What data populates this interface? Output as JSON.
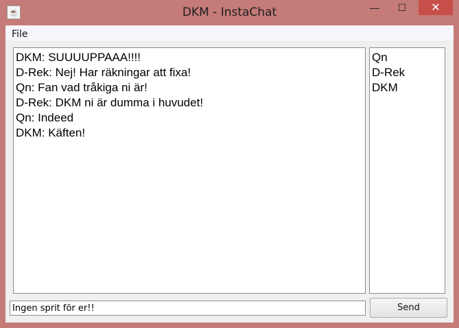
{
  "window": {
    "title": "DKM - InstaChat",
    "app_icon": "java-icon",
    "minimize_glyph": "—",
    "maximize_glyph": "☐",
    "close_glyph": "✕"
  },
  "menu": {
    "items": [
      "File"
    ]
  },
  "chat": {
    "messages": [
      "DKM: SUUUUPPAAA!!!!",
      "D-Rek: Nej! Har räkningar att fixa!",
      "Qn: Fan vad tråkiga ni är!",
      "D-Rek: DKM ni är dumma i huvudet!",
      "Qn: Indeed",
      "DKM: Käften!"
    ]
  },
  "users": {
    "items": [
      "Qn",
      "D-Rek",
      "DKM"
    ]
  },
  "composer": {
    "value": "Ingen sprit för er!!",
    "send_label": "Send"
  },
  "colors": {
    "frame": "#c57b78",
    "close_button": "#c7504b"
  }
}
